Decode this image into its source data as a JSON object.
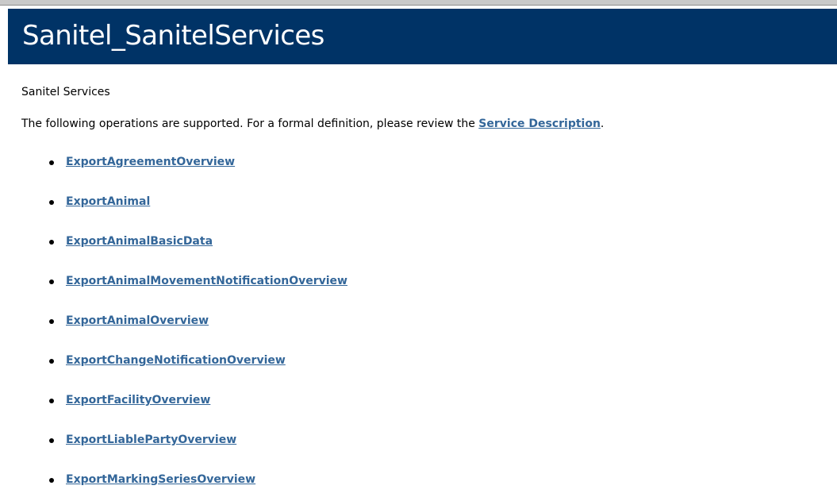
{
  "heading": "Sanitel_SanitelServices",
  "service_name": "Sanitel Services",
  "intro": {
    "text_before": "The following operations are supported. For a formal definition, please review the ",
    "link_label": "Service Description",
    "text_after": "."
  },
  "operations": [
    "ExportAgreementOverview",
    "ExportAnimal",
    "ExportAnimalBasicData",
    "ExportAnimalMovementNotificationOverview",
    "ExportAnimalOverview",
    "ExportChangeNotificationOverview",
    "ExportFacilityOverview",
    "ExportLiablePartyOverview",
    "ExportMarkingSeriesOverview"
  ],
  "colors": {
    "heading_bar": "#003366",
    "link": "#336699"
  }
}
